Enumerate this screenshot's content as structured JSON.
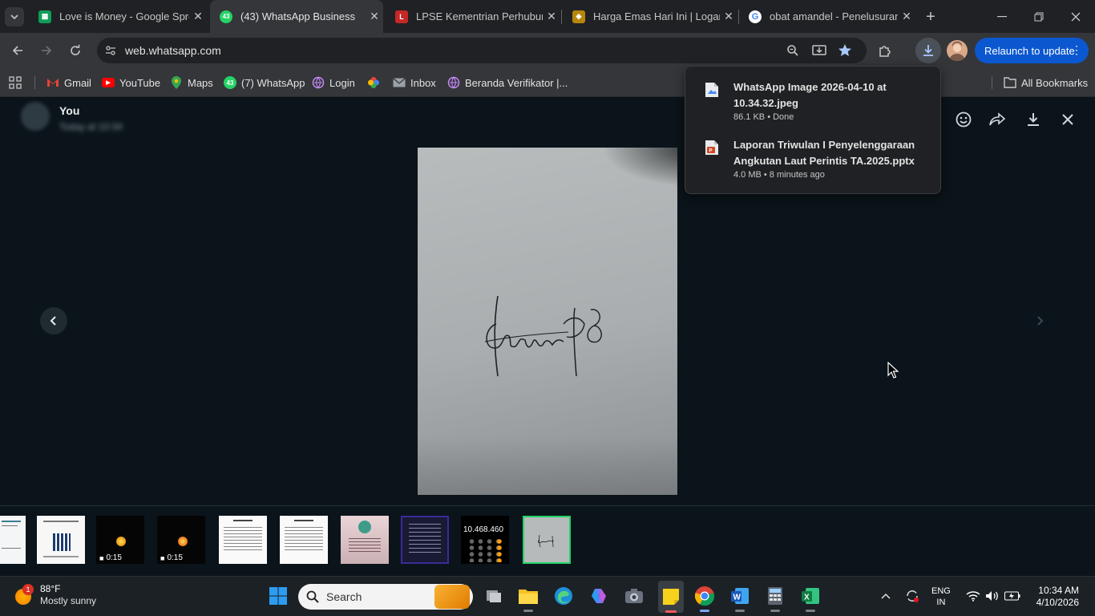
{
  "tabs": [
    {
      "title": "Love is Money - Google Spre",
      "favicon": "sheets-icon"
    },
    {
      "title": "(43) WhatsApp Business",
      "favicon": "whatsapp-icon",
      "badge": "43",
      "active": true
    },
    {
      "title": "LPSE Kementrian Perhubung",
      "favicon": "lpse-icon"
    },
    {
      "title": "Harga Emas Hari Ini | Logam",
      "favicon": "gold-icon"
    },
    {
      "title": "obat amandel - Penelusuran",
      "favicon": "google-icon"
    }
  ],
  "toolbar": {
    "url": "web.whatsapp.com",
    "relaunch_label": "Relaunch to update"
  },
  "bookmarks": {
    "items": [
      {
        "label": "Gmail",
        "icon": "gmail-icon"
      },
      {
        "label": "YouTube",
        "icon": "youtube-icon"
      },
      {
        "label": "Maps",
        "icon": "maps-icon"
      },
      {
        "label": "(7) WhatsApp",
        "icon": "whatsapp-icon",
        "badge": "43"
      },
      {
        "label": "Login",
        "icon": "login-icon"
      },
      {
        "label": "",
        "icon": "pinwheel-icon"
      },
      {
        "label": "Inbox",
        "icon": "mail-icon"
      },
      {
        "label": "Beranda Verifikator |...",
        "icon": "verifikator-icon"
      }
    ],
    "all_label": "All Bookmarks"
  },
  "downloads": [
    {
      "name": "WhatsApp Image 2026-04-10 at 10.34.32.jpeg",
      "meta": "86.1 KB • Done",
      "icon": "image-file-icon"
    },
    {
      "name": "Laporan Triwulan I Penyelenggaraan Angkutan Laut Perintis TA.2025.pptx",
      "meta": "4.0 MB • 8 minutes ago",
      "icon": "powerpoint-file-icon"
    }
  ],
  "viewer": {
    "sender": "You",
    "thumbnails": [
      {
        "kind": "document"
      },
      {
        "kind": "qr-document"
      },
      {
        "kind": "video",
        "duration": "0:15"
      },
      {
        "kind": "video",
        "duration": "0:15"
      },
      {
        "kind": "document"
      },
      {
        "kind": "document"
      },
      {
        "kind": "certificate"
      },
      {
        "kind": "dark-screen"
      },
      {
        "kind": "calculator",
        "display": "10.468.460"
      },
      {
        "kind": "signature",
        "selected": true
      }
    ]
  },
  "taskbar": {
    "weather_temp": "88°F",
    "weather_desc": "Mostly sunny",
    "weather_badge": "1",
    "search_placeholder": "Search",
    "lang_top": "ENG",
    "lang_bottom": "IN",
    "time": "10:34 AM",
    "date": "4/10/2026"
  },
  "colors": {
    "accent_green": "#25d366",
    "relaunch_blue": "#0b57d0",
    "viewer_bg": "#0b141a"
  }
}
